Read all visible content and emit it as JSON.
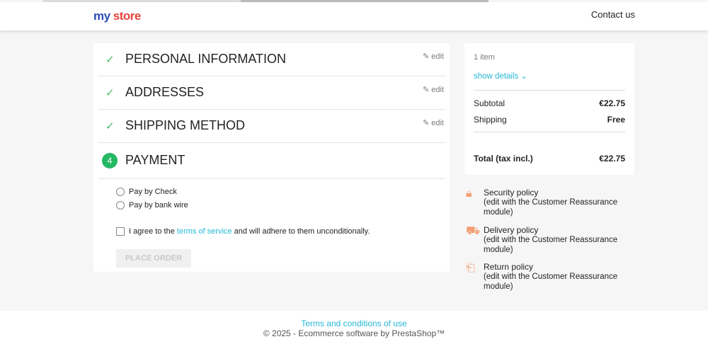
{
  "header": {
    "logo": "my store",
    "contact": "Contact us"
  },
  "steps": [
    {
      "title": "PERSONAL INFORMATION",
      "edit": "edit"
    },
    {
      "title": "ADDRESSES",
      "edit": "edit"
    },
    {
      "title": "SHIPPING METHOD",
      "edit": "edit"
    },
    {
      "number": "4",
      "title": "PAYMENT"
    }
  ],
  "payment": {
    "options": [
      "Pay by Check",
      "Pay by bank wire"
    ],
    "terms_pre": "I agree to the ",
    "terms_link": "terms of service",
    "terms_post": " and will adhere to them unconditionally.",
    "place_order": "PLACE ORDER"
  },
  "summary": {
    "items": "1 item",
    "show_details": "show details",
    "subtotal_label": "Subtotal",
    "subtotal": "€22.75",
    "shipping_label": "Shipping",
    "shipping": "Free",
    "total_label": "Total (tax incl.)",
    "total": "€22.75"
  },
  "reassurance": [
    {
      "title": "Security policy",
      "desc": "(edit with the Customer Reassurance module)"
    },
    {
      "title": "Delivery policy",
      "desc": "(edit with the Customer Reassurance module)"
    },
    {
      "title": "Return policy",
      "desc": "(edit with the Customer Reassurance module)"
    }
  ],
  "footer": {
    "terms": "Terms and conditions of use",
    "copyright": "© 2025 - Ecommerce software by PrestaShop™"
  }
}
